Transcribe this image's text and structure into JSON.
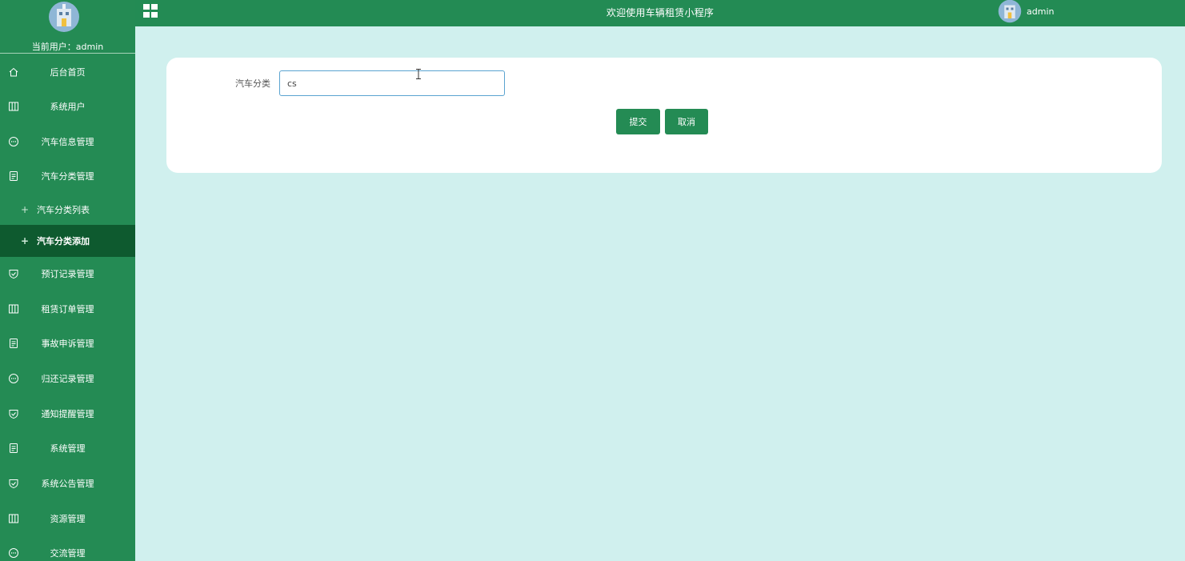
{
  "header": {
    "title": "欢迎使用车辆租赁小程序",
    "username": "admin"
  },
  "sidebar": {
    "current_user_label": "当前用户：",
    "current_user": "admin",
    "items": [
      {
        "label": "后台首页",
        "icon": "home-icon"
      },
      {
        "label": "系统用户",
        "icon": "columns-icon"
      },
      {
        "label": "汽车信息管理",
        "icon": "chat-icon"
      },
      {
        "label": "汽车分类管理",
        "icon": "document-icon"
      },
      {
        "label": "汽车分类列表",
        "icon": "plus-icon",
        "sub": true
      },
      {
        "label": "汽车分类添加",
        "icon": "plus-icon",
        "sub": true,
        "active": true
      },
      {
        "label": "预订记录管理",
        "icon": "shield-icon"
      },
      {
        "label": "租赁订单管理",
        "icon": "columns-icon"
      },
      {
        "label": "事故申诉管理",
        "icon": "document-icon"
      },
      {
        "label": "归还记录管理",
        "icon": "chat-icon"
      },
      {
        "label": "通知提醒管理",
        "icon": "shield-icon"
      },
      {
        "label": "系统管理",
        "icon": "document-icon"
      },
      {
        "label": "系统公告管理",
        "icon": "shield-icon"
      },
      {
        "label": "资源管理",
        "icon": "columns-icon"
      },
      {
        "label": "交流管理",
        "icon": "chat-icon"
      }
    ]
  },
  "form": {
    "category_label": "汽车分类",
    "category_value": "cs",
    "submit_label": "提交",
    "cancel_label": "取消"
  },
  "colors": {
    "primary": "#248b54",
    "active": "#0e5a2f",
    "background": "#d0f0ee"
  }
}
